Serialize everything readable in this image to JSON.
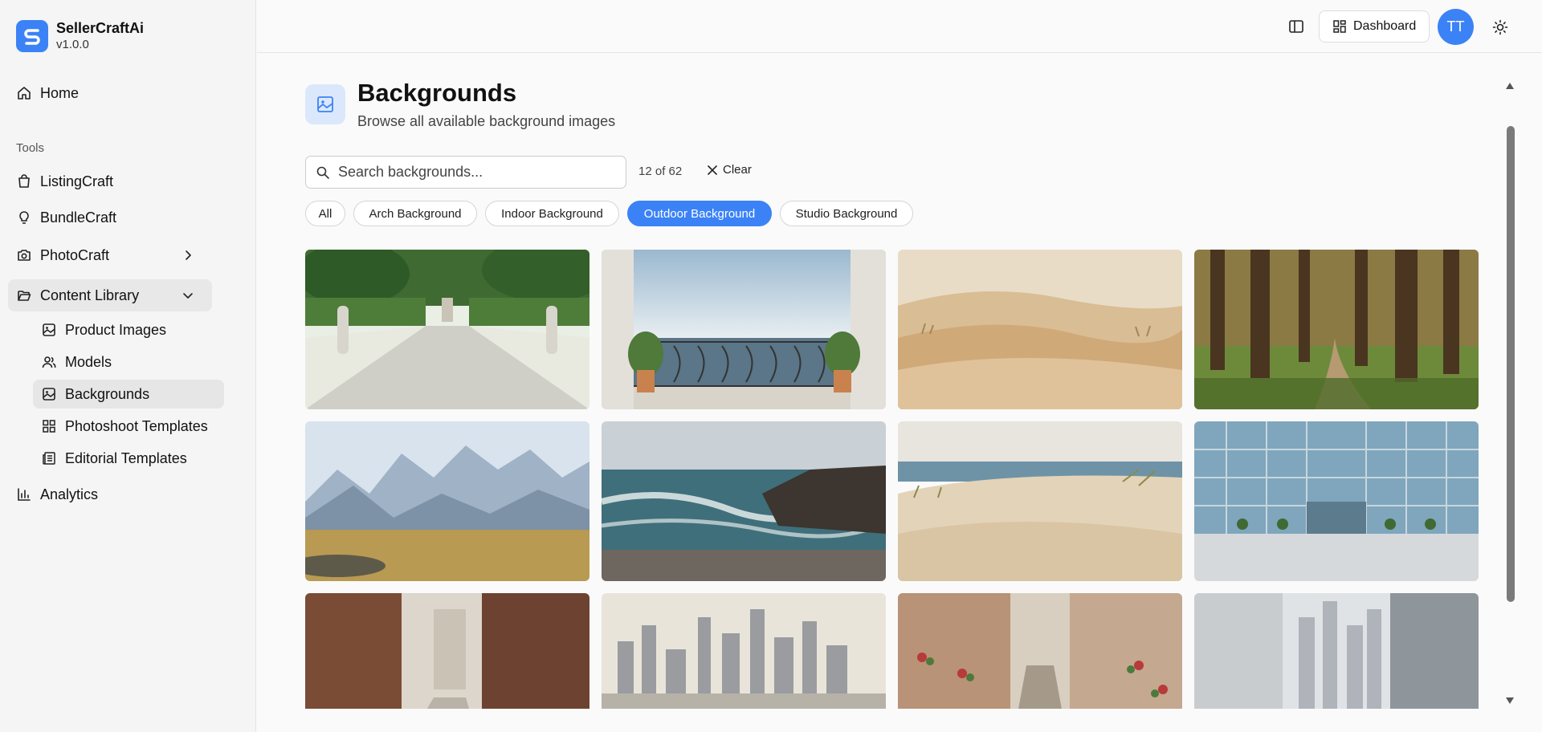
{
  "app": {
    "name": "SellerCraftAi",
    "version": "v1.0.0"
  },
  "sidebar": {
    "home": "Home",
    "tools_label": "Tools",
    "tools": [
      "ListingCraft",
      "BundleCraft",
      "PhotoCraft"
    ],
    "content_library": "Content Library",
    "library_items": [
      "Product Images",
      "Models",
      "Backgrounds",
      "Photoshoot Templates",
      "Editorial Templates"
    ],
    "analytics": "Analytics"
  },
  "topbar": {
    "dashboard_label": "Dashboard",
    "avatar_initials": "TT"
  },
  "page": {
    "title": "Backgrounds",
    "subtitle": "Browse all available background images"
  },
  "search": {
    "placeholder": "Search backgrounds...",
    "value": ""
  },
  "results": {
    "count": "12 of 62",
    "clear_label": "Clear"
  },
  "filters": [
    {
      "label": "All",
      "selected": false
    },
    {
      "label": "Arch Background",
      "selected": false
    },
    {
      "label": "Indoor Background",
      "selected": false
    },
    {
      "label": "Outdoor Background",
      "selected": true
    },
    {
      "label": "Studio Background",
      "selected": false
    }
  ],
  "gallery": [
    "garden-statues",
    "balcony-sea-view",
    "desert-dunes",
    "forest-path",
    "mountain-meadow",
    "ocean-rocks",
    "beach-dunes",
    "glass-building-plaza",
    "brick-alley",
    "city-skyline-rooftop",
    "old-town-street",
    "modern-city-street"
  ],
  "colors": {
    "accent": "#3b82f6",
    "accent_soft": "#dbe8fb"
  }
}
